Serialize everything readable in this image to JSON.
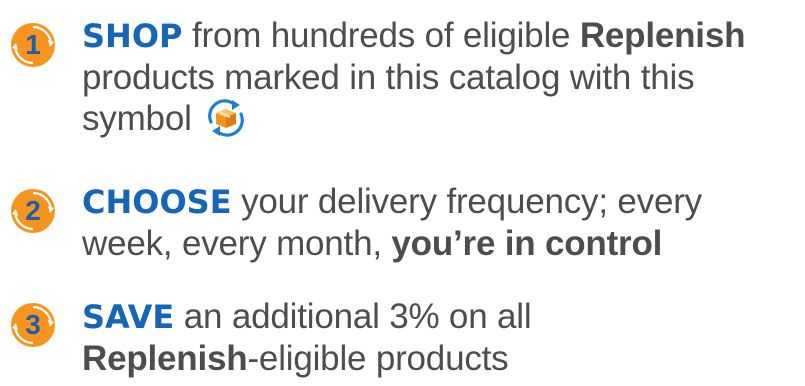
{
  "steps": [
    {
      "number": "1",
      "keyword": "SHOP",
      "text_a": " from hundreds of eligible ",
      "bold_a": "Replenish",
      "text_b": " products marked in this catalog with this symbol",
      "symbol_icon": "replenish-box-icon"
    },
    {
      "number": "2",
      "keyword": "CHOOSE",
      "text_a": " your delivery frequency; every week, every month, ",
      "bold_a": "you’re in control"
    },
    {
      "number": "3",
      "keyword": "SAVE",
      "text_a": " an additional 3% on all ",
      "bold_a": "Replenish",
      "text_b": "-eligible products"
    }
  ],
  "colors": {
    "badge_orange": "#f7941d",
    "badge_ring": "#1f5ea8",
    "keyword_blue": "#1565b8",
    "body_text": "#4d4d4f"
  }
}
